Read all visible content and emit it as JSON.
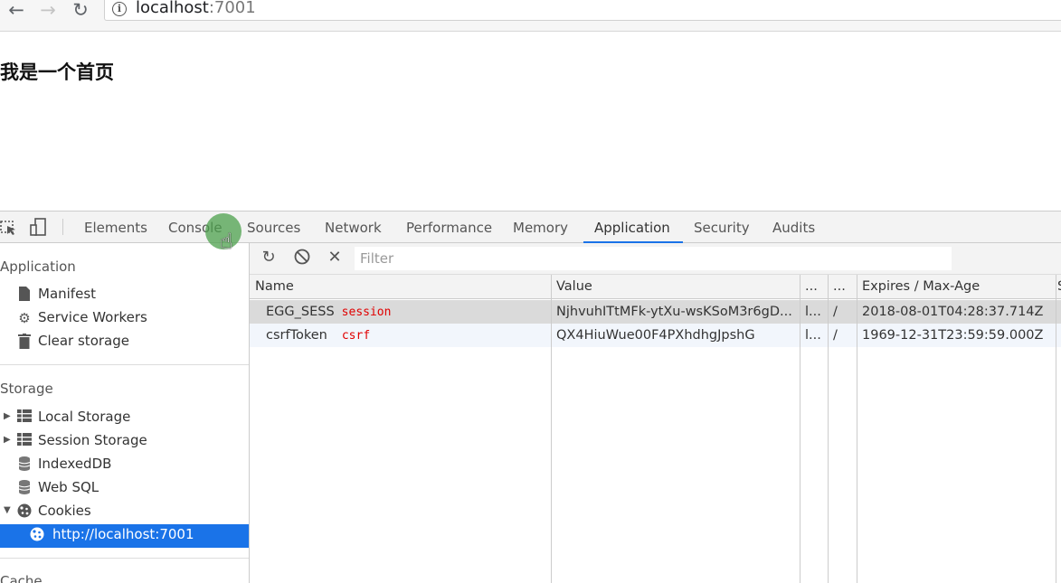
{
  "browser": {
    "url_host": "localhost",
    "url_port": ":7001"
  },
  "page": {
    "heading": "我是一个首页"
  },
  "devtools": {
    "tabs": [
      "Elements",
      "Console",
      "Sources",
      "Network",
      "Performance",
      "Memory",
      "Application",
      "Security",
      "Audits"
    ],
    "active_tab": "Application",
    "sidebar": {
      "application_header": "Application",
      "application_items": [
        "Manifest",
        "Service Workers",
        "Clear storage"
      ],
      "storage_header": "Storage",
      "storage_items": [
        "Local Storage",
        "Session Storage",
        "IndexedDB",
        "Web SQL",
        "Cookies"
      ],
      "cookies_child": "http://localhost:7001",
      "cache_header": "Cache"
    },
    "toolbar": {
      "filter_placeholder": "Filter"
    },
    "table": {
      "columns": [
        "Name",
        "Value",
        "...",
        "...",
        "Expires / Max-Age",
        "S"
      ],
      "rows": [
        {
          "name": "EGG_SESS",
          "annotation": "session",
          "value": "NjhvuhITtMFk-ytXu-wsKSoM3r6gD...",
          "domain": "l...",
          "path": "/",
          "expires": "2018-08-01T04:28:37.714Z"
        },
        {
          "name": "csrfToken",
          "annotation": "csrf",
          "value": "QX4HiuWue00F4PXhdhgJpshG",
          "domain": "l...",
          "path": "/",
          "expires": "1969-12-31T23:59:59.000Z"
        }
      ]
    }
  },
  "colors": {
    "accent": "#1a73e8",
    "annotation": "#e00000",
    "cursor_highlight": "#4ca04c"
  },
  "icons": [
    "back-arrow-icon",
    "forward-arrow-icon",
    "reload-icon",
    "info-icon",
    "inspect-icon",
    "device-toolbar-icon",
    "document-icon",
    "gear-icon",
    "trash-icon",
    "grid-icon",
    "database-icon",
    "cookie-icon",
    "refresh-icon",
    "block-icon",
    "close-icon",
    "hand-cursor-icon"
  ]
}
